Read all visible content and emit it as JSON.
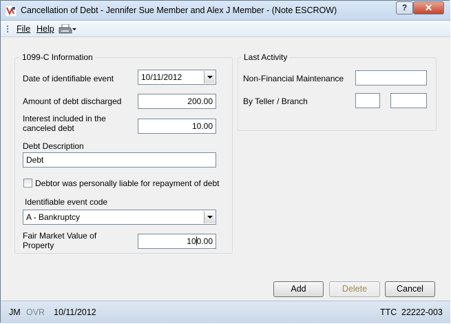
{
  "window": {
    "title": "Cancellation of Debt - Jennifer Sue Member and Alex J Member - (Note ESCROW)",
    "help_label": "?",
    "close_label": "✕"
  },
  "menu": {
    "file_label": "File",
    "help_label": "Help",
    "print_icon": "printer-icon"
  },
  "info_1099c": {
    "legend": "1099-C Information",
    "date_event_label": "Date of identifiable event",
    "date_event_value": "10/11/2012",
    "amount_discharged_label": "Amount of debt discharged",
    "amount_discharged_value": "200.00",
    "interest_label_1": "Interest included in the",
    "interest_label_2": "canceled debt",
    "interest_value": "10.00",
    "description_label": "Debt Description",
    "description_value": "Debt",
    "liable_label": "Debtor was personally liable for repayment of debt",
    "liable_checked": false,
    "event_code_label": "Identifiable event code",
    "event_code_value": "A - Bankruptcy",
    "fmv_label_1": "Fair Market Value of",
    "fmv_label_2": "Property",
    "fmv_value_before_cursor": "10",
    "fmv_value_after_cursor": "0.00"
  },
  "last_activity": {
    "legend": "Last Activity",
    "nonfin_label": "Non-Financial Maintenance",
    "nonfin_value": "",
    "teller_label": "By Teller / Branch",
    "teller_value": "",
    "branch_value": ""
  },
  "buttons": {
    "add": "Add",
    "delete": "Delete",
    "cancel": "Cancel"
  },
  "status": {
    "user": "JM",
    "ovr": "OVR",
    "date": "10/11/2012",
    "ttc_label": "TTC",
    "ttc_value": "22222-003"
  }
}
